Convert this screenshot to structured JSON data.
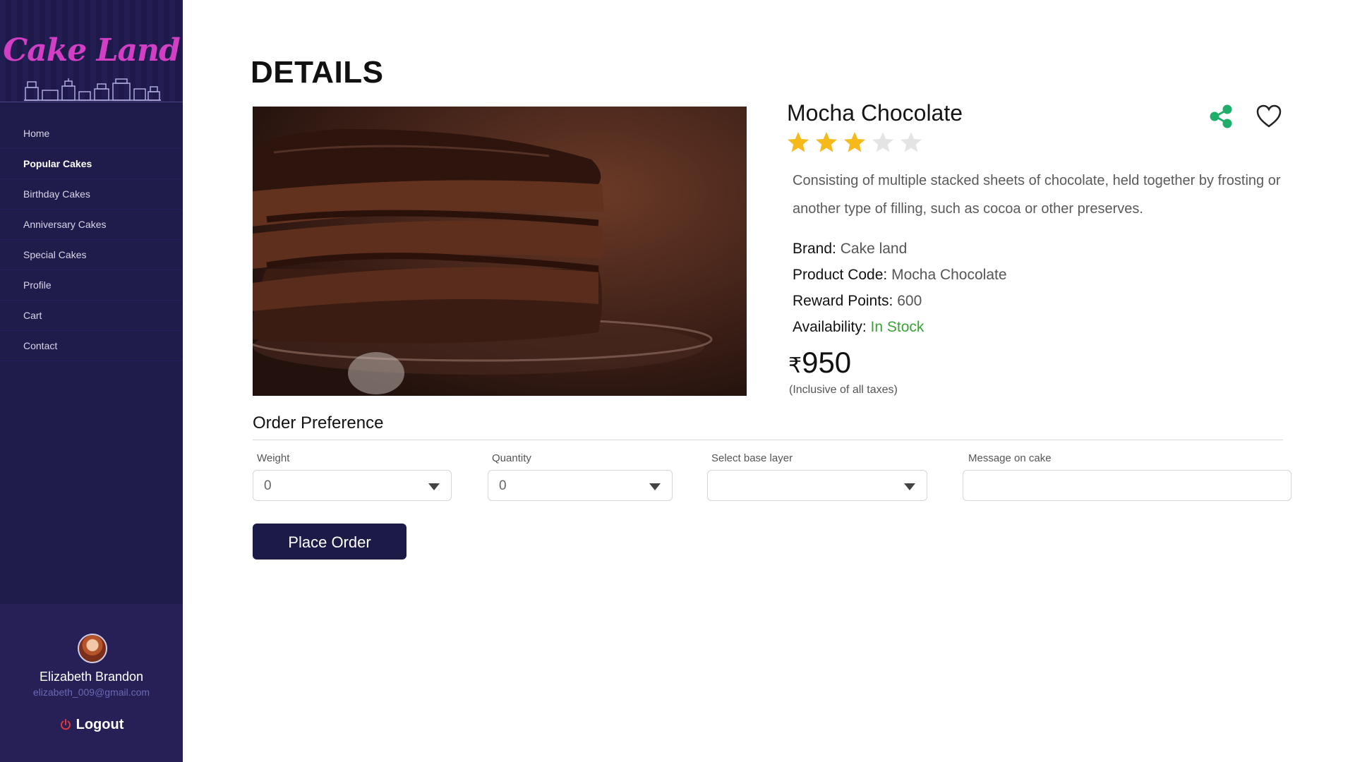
{
  "brand": {
    "name": "Cake Land",
    "logo_color": "#d23fc4"
  },
  "sidebar": {
    "bg_color": "#1f1b4b",
    "items": [
      {
        "label": "Home",
        "active": false
      },
      {
        "label": "Popular Cakes",
        "active": true
      },
      {
        "label": "Birthday Cakes",
        "active": false
      },
      {
        "label": "Anniversary Cakes",
        "active": false
      },
      {
        "label": "Special Cakes",
        "active": false
      },
      {
        "label": "Profile",
        "active": false
      },
      {
        "label": "Cart",
        "active": false
      },
      {
        "label": "Contact",
        "active": false
      }
    ]
  },
  "user": {
    "name": "Elizabeth Brandon",
    "email": "elizabeth_009@gmail.com",
    "logout_label": "Logout"
  },
  "page": {
    "title": "DETAILS"
  },
  "product": {
    "name": "Mocha Chocolate",
    "rating": 3,
    "rating_max": 5,
    "description": "Consisting of multiple stacked sheets of chocolate, held together by frosting or another type of filling, such as cocoa or other preserves.",
    "brand_label": "Brand:",
    "brand_value": "Cake land",
    "code_label": "Product Code:",
    "code_value": "Mocha Chocolate",
    "reward_label": "Reward Points:",
    "reward_value": "600",
    "availability_label": "Availability:",
    "availability_value": "In Stock",
    "currency_symbol": "₹",
    "price": "950",
    "tax_note": "(Inclusive of all taxes)",
    "image_icon": "chocolate-cake-photo"
  },
  "order": {
    "heading": "Order Preference",
    "weight": {
      "label": "Weight",
      "value": "0"
    },
    "quantity": {
      "label": "Quantity",
      "value": "0"
    },
    "base_layer": {
      "label": "Select base layer",
      "value": ""
    },
    "message": {
      "label": "Message on cake",
      "value": ""
    },
    "place_order_label": "Place Order"
  },
  "colors": {
    "star_filled": "#f6b91a",
    "star_empty": "#e4e4e4",
    "share": "#1fae6a",
    "in_stock": "#3aa336",
    "button": "#1c1a47"
  },
  "icons": {
    "share": "share-icon",
    "favorite": "heart-icon",
    "logout": "power-icon",
    "dropdown": "chevron-down-icon"
  }
}
